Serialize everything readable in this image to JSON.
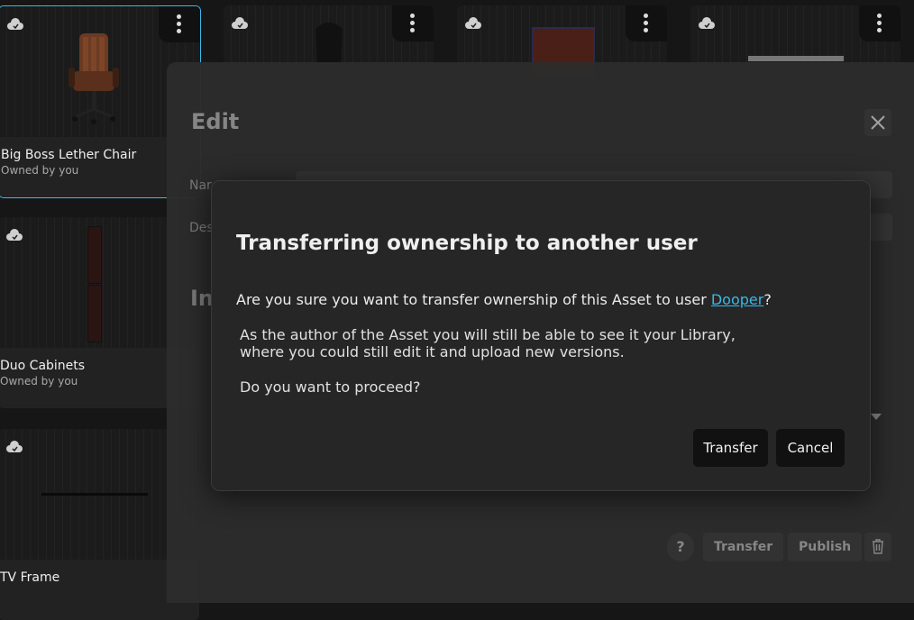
{
  "library": {
    "assets": [
      {
        "name": "Big Boss Lether Chair",
        "owner": "Owned by you"
      },
      {
        "name": "Duo Cabinets",
        "owner": "Owned by you"
      },
      {
        "name": "TV Frame",
        "owner": ""
      }
    ]
  },
  "edit_panel": {
    "title": "Edit",
    "name_label": "Nar",
    "description_label": "Des",
    "section_heading": "In",
    "help_label": "?",
    "transfer_label": "Transfer",
    "publish_label": "Publish"
  },
  "dialog": {
    "title": "Transferring ownership to another user",
    "question_prefix": "Are you sure you want to transfer ownership of this Asset to user ",
    "username": "Dooper",
    "question_suffix": "?",
    "body_line1": "As the author of the Asset you will still be able to see it your Library,",
    "body_line2": "where you could still edit it and upload new versions.",
    "proceed": "Do you want to proceed?",
    "transfer_button": "Transfer",
    "cancel_button": "Cancel"
  },
  "colors": {
    "accent": "#3bb7e8",
    "dialog_bg": "#262626",
    "button_bg": "#111111"
  }
}
